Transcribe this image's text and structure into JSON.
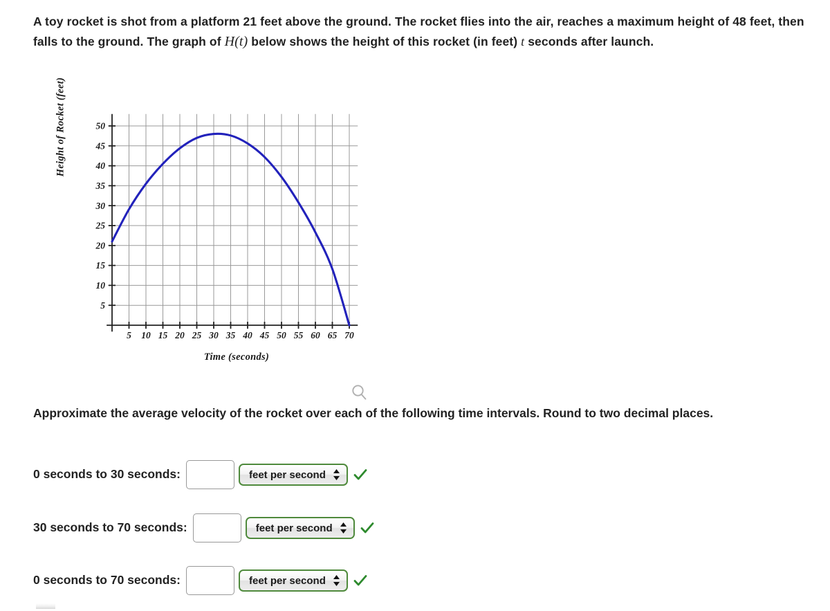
{
  "problem": {
    "text_part1": "A toy rocket is shot from a platform 21 feet above the ground. The rocket flies into the air, reaches a maximum height of 48 feet, then falls to the ground. The graph of ",
    "function_symbol": "H(t)",
    "text_part2": " below shows the height of this rocket (in feet) ",
    "variable_symbol": "t",
    "text_part3": " seconds after launch."
  },
  "prompt": {
    "text": "Approximate the average velocity of the rocket over each of the following time intervals. Round to two decimal places."
  },
  "icons": {
    "magnifier": "magnifier-icon",
    "stepper": "updown-stepper-icon",
    "check": "green-check-icon"
  },
  "colors": {
    "curve": "#2222bb",
    "grid": "#999999",
    "axis": "#222222",
    "select_border": "#4f8a3c",
    "check": "#2d8a2d"
  },
  "chart_data": {
    "type": "line",
    "title": "",
    "xlabel": "Time (seconds)",
    "ylabel": "Height of Rocket (feet)",
    "xlim": [
      0,
      72
    ],
    "ylim": [
      0,
      53
    ],
    "xticks": [
      5,
      10,
      15,
      20,
      25,
      30,
      35,
      40,
      45,
      50,
      55,
      60,
      65,
      70
    ],
    "yticks": [
      5,
      10,
      15,
      20,
      25,
      30,
      35,
      40,
      45,
      50
    ],
    "grid": true,
    "legend": "none",
    "series": [
      {
        "name": "H(t)",
        "color": "#2222bb",
        "x": [
          0,
          5,
          10,
          15,
          20,
          25,
          30,
          35,
          40,
          45,
          50,
          55,
          60,
          65,
          70
        ],
        "y": [
          21,
          29.1,
          35.5,
          40.5,
          44.4,
          47.0,
          48.0,
          47.6,
          45.6,
          42.2,
          37.2,
          30.8,
          23.3,
          14.1,
          0.0
        ]
      }
    ],
    "annotations": {
      "initial_height": 21,
      "max_height": 48,
      "time_at_max": 30,
      "landing_time": 70
    }
  },
  "answers": {
    "rows": [
      {
        "label": "0 seconds to 30 seconds:",
        "value": "",
        "placeholder": "",
        "unit": "feet per second"
      },
      {
        "label": "30 seconds to 70 seconds:",
        "value": "",
        "placeholder": "",
        "unit": "feet per second"
      },
      {
        "label": "0 seconds to 70 seconds:",
        "value": "",
        "placeholder": "",
        "unit": "feet per second"
      }
    ]
  }
}
